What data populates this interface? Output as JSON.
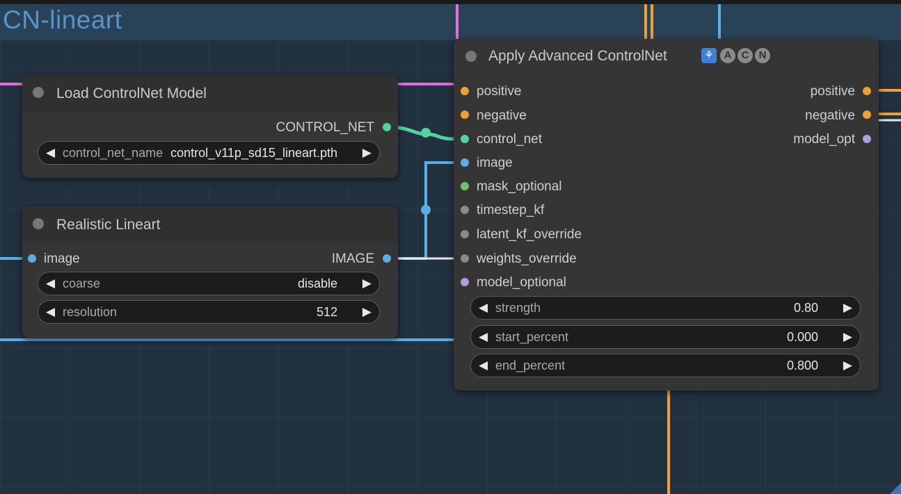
{
  "group": {
    "title": "CN-lineart"
  },
  "colors": {
    "positive": "#f0a030",
    "negative": "#f0a030",
    "control_net": "#4fd49a",
    "image": "#5aaee8",
    "mask": "#6fc06f",
    "model": "#b39be0",
    "inactive": "#8a8a8a"
  },
  "load_model": {
    "title": "Load ControlNet Model",
    "output_label": "CONTROL_NET",
    "widget": {
      "name": "control_net_name",
      "value": "control_v11p_sd15_lineart.pth"
    }
  },
  "lineart": {
    "title": "Realistic Lineart",
    "input_label": "image",
    "output_label": "IMAGE",
    "widgets": [
      {
        "name": "coarse",
        "value": "disable"
      },
      {
        "name": "resolution",
        "value": "512"
      }
    ]
  },
  "apply": {
    "title": "Apply Advanced ControlNet",
    "badges": [
      "A",
      "C",
      "N"
    ],
    "badge_icon": "puzzle-icon",
    "inputs": [
      "positive",
      "negative",
      "control_net",
      "image",
      "mask_optional",
      "timestep_kf",
      "latent_kf_override",
      "weights_override",
      "model_optional"
    ],
    "outputs": [
      "positive",
      "negative",
      "model_opt"
    ],
    "widgets": [
      {
        "name": "strength",
        "value": "0.80"
      },
      {
        "name": "start_percent",
        "value": "0.000"
      },
      {
        "name": "end_percent",
        "value": "0.800"
      }
    ]
  }
}
